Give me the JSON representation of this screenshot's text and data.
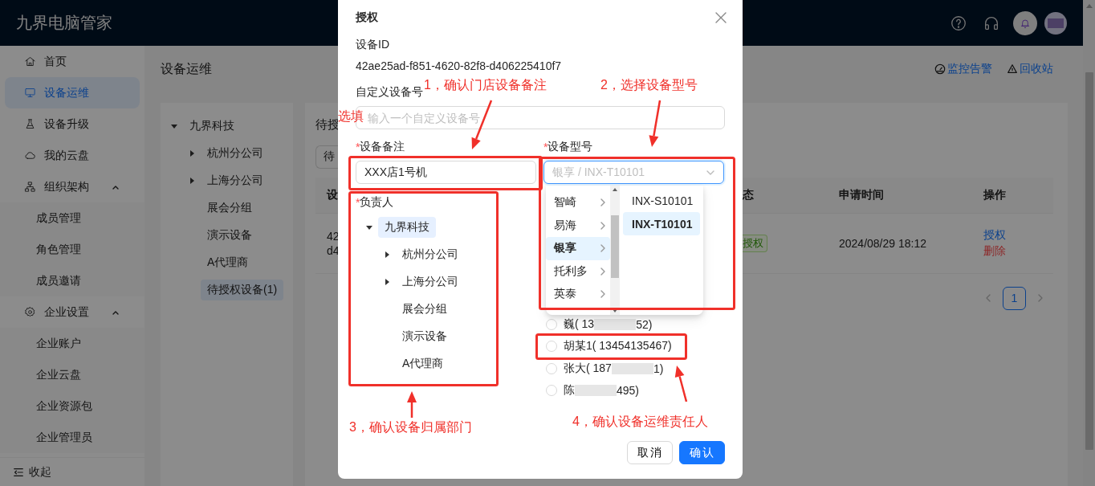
{
  "header": {
    "title": "九界电脑管家"
  },
  "sidebar": {
    "items": [
      {
        "label": "首页",
        "selected": false
      },
      {
        "label": "设备运维",
        "selected": true
      },
      {
        "label": "设备升级",
        "selected": false
      },
      {
        "label": "我的云盘",
        "selected": false
      },
      {
        "label": "组织架构",
        "selected": false,
        "expanded": true,
        "children": [
          {
            "label": "成员管理",
            "selected": false
          },
          {
            "label": "角色管理",
            "selected": false
          },
          {
            "label": "成员邀请",
            "selected": false
          }
        ]
      },
      {
        "label": "企业设置",
        "selected": false,
        "expanded": true,
        "children": [
          {
            "label": "企业账户",
            "selected": false
          },
          {
            "label": "企业云盘",
            "selected": false
          },
          {
            "label": "企业资源包",
            "selected": false
          },
          {
            "label": "企业管理员",
            "selected": false
          }
        ]
      }
    ],
    "collapse_label": "收起"
  },
  "page": {
    "title": "设备运维",
    "links": [
      "监控告警",
      "回收站"
    ]
  },
  "dept_tree": [
    {
      "label": "九界科技",
      "kind": "folder",
      "expanded": true,
      "selected": false,
      "children": [
        {
          "label": "杭州分公司",
          "kind": "folder",
          "expanded": false,
          "selected": false
        },
        {
          "label": "上海分公司",
          "kind": "folder",
          "expanded": false,
          "selected": false
        },
        {
          "label": "展会分组",
          "kind": "leaf",
          "selected": false
        },
        {
          "label": "演示设备",
          "kind": "leaf",
          "selected": false
        },
        {
          "label": "A代理商",
          "kind": "leaf",
          "selected": false
        },
        {
          "label": "待授权设备(1)",
          "kind": "leaf",
          "selected": true
        }
      ]
    }
  ],
  "card": {
    "tab_fragment": "待授",
    "filter_fragment": "待",
    "columns": [
      "设",
      "态",
      "申请时间",
      "操作"
    ],
    "rows": [
      {
        "id_lines": [
          "42",
          "d4"
        ],
        "status": "授权",
        "time": "2024/08/29 18:12",
        "actions": [
          {
            "label": "授权",
            "kind": "primary"
          },
          {
            "label": "删除",
            "kind": "danger"
          }
        ]
      }
    ],
    "pages": [
      {
        "label": "1",
        "selected": true
      }
    ]
  },
  "dialog": {
    "title": "授权",
    "device_id_label": "设备ID",
    "device_id": "42ae25ad-f851-4620-82f8-d406225410f7",
    "custom_label": "自定义设备号",
    "custom_field": {
      "placeholder": "输入一个自定义设备号"
    },
    "remark": {
      "mark": "*",
      "label": "设备备注",
      "value": "XXX店1号机"
    },
    "model": {
      "mark": "*",
      "label": "设备型号",
      "placeholder": "银享 / INX-T10101",
      "focused": true
    },
    "owner": {
      "mark": "*",
      "label": "负责人",
      "tree": [
        {
          "label": "九界科技",
          "kind": "folder",
          "expanded": true,
          "selected": true,
          "children": [
            {
              "label": "杭州分公司",
              "kind": "folder",
              "expanded": false,
              "selected": false
            },
            {
              "label": "上海分公司",
              "kind": "folder",
              "expanded": false,
              "selected": false
            },
            {
              "label": "展会分组",
              "kind": "leaf",
              "selected": false
            },
            {
              "label": "演示设备",
              "kind": "leaf",
              "selected": false
            },
            {
              "label": "A代理商",
              "kind": "leaf",
              "selected": false
            }
          ]
        }
      ]
    },
    "model_menu": {
      "brands": [
        {
          "label": "智崎",
          "selected": false
        },
        {
          "label": "易海",
          "selected": false
        },
        {
          "label": "银享",
          "selected": true
        },
        {
          "label": "托利多",
          "selected": false
        },
        {
          "label": "英泰",
          "selected": false
        }
      ],
      "models": [
        {
          "label": "INX-S10101",
          "selected": false
        },
        {
          "label": "INX-T10101",
          "selected": true
        }
      ]
    },
    "people": [
      {
        "parts": [
          "巍( 13",
          "52)"
        ],
        "selected": false
      },
      {
        "parts": [
          "胡某1( 13454135467)"
        ],
        "selected": false
      },
      {
        "parts": [
          "张大( 187",
          "1)"
        ],
        "selected": false
      },
      {
        "parts": [
          "陈",
          "495)"
        ],
        "selected": false
      }
    ],
    "buttons": [
      {
        "label": "取消",
        "kind": "default"
      },
      {
        "label": "确认",
        "kind": "primary"
      }
    ]
  },
  "annotations": {
    "notes": [
      "选填",
      "1，确认门店设备备注",
      "2，选择设备型号",
      "3，确认设备归属部门",
      "4，确认设备运维责任人"
    ]
  }
}
